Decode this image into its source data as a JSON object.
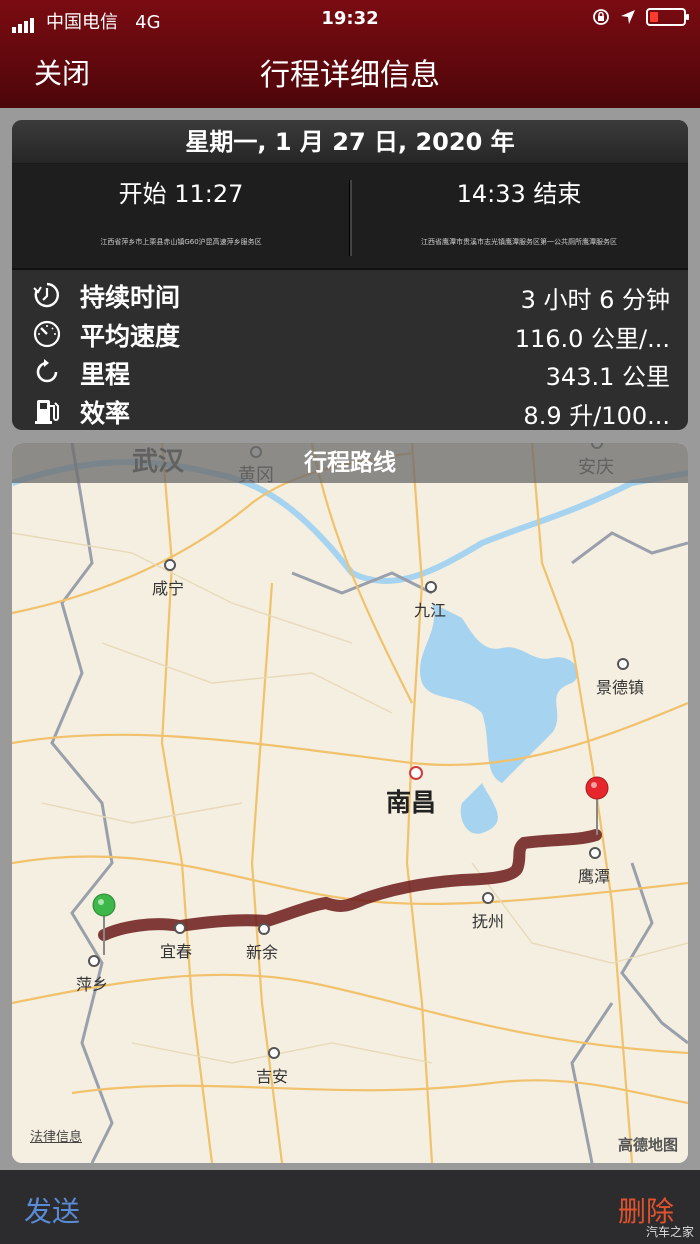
{
  "status_bar": {
    "carrier": "中国电信",
    "network": "4G",
    "time": "19:32",
    "battery_level": 0.2
  },
  "nav": {
    "close_label": "关闭",
    "title": "行程详细信息"
  },
  "trip": {
    "date": "星期一, 1 月 27 日, 2020 年",
    "start_time": "开始 11:27",
    "start_address": "江西省萍乡市上栗县赤山镇G60沪昆高速萍乡服务区",
    "end_time": "14:33 结束",
    "end_address": "江西省鹰潭市贵溪市志光镇鹰潭服务区第一公共厕所鹰潭服务区"
  },
  "stats": [
    {
      "icon": "stopwatch-icon",
      "label": "持续时间",
      "value": "3 小时 6 分钟"
    },
    {
      "icon": "speedometer-icon",
      "label": "平均速度",
      "value": "116.0 公里/..."
    },
    {
      "icon": "refresh-icon",
      "label": "里程",
      "value": "343.1 公里"
    },
    {
      "icon": "fuel-pump-icon",
      "label": "效率",
      "value": "8.9 升/100..."
    }
  ],
  "map": {
    "route_title": "行程路线",
    "legal_label": "法律信息",
    "provider_label": "高德地图",
    "cities": {
      "wuhan": "武汉",
      "huanggang": "黄冈",
      "anqing": "安庆",
      "xianning": "咸宁",
      "jiujiang": "九江",
      "jingdezhen": "景德镇",
      "nanchang": "南昌",
      "yingtan": "鹰潭",
      "fuzhou": "抚州",
      "pingxiang": "萍乡",
      "yichun": "宜春",
      "xinyu": "新余",
      "jian": "吉安"
    },
    "route_color": "#6b1a1a",
    "start_pin_color": "#3db64a",
    "end_pin_color": "#e6262c",
    "water_color": "#a6d3ef"
  },
  "toolbar": {
    "send_label": "发送",
    "delete_label": "删除"
  },
  "watermark": "汽车之家"
}
